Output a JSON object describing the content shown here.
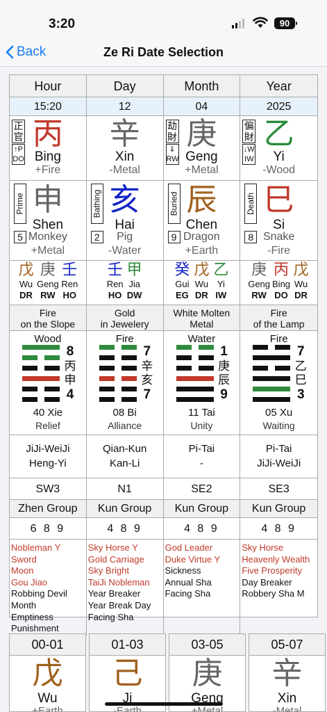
{
  "status": {
    "time": "3:20",
    "battery": "90"
  },
  "nav": {
    "back": "Back",
    "title": "Ze Ri Date Selection"
  },
  "colors": {
    "red": "#c0392b",
    "green": "#2e8b3d",
    "blue": "#1524c8",
    "brown": "#a0611e",
    "gray": "#666666",
    "black": "#111111"
  },
  "pillars": [
    {
      "header": "Hour",
      "value": "15:20",
      "stem": {
        "char": "丙",
        "pinyin": "Bing",
        "element": "+Fire",
        "color": "#c0392b",
        "god_chars": [
          "正",
          "官"
        ],
        "god_abbr": [
          "↑P",
          "DO"
        ]
      },
      "branch": {
        "char": "申",
        "pinyin": "Shen",
        "animal": "Monkey",
        "element": "+Metal",
        "color": "#666666",
        "stage": "Prime",
        "stage_num": "5"
      },
      "hidden": [
        {
          "char": "戊",
          "pinyin": "Wu",
          "god": "DR",
          "color": "#a0611e"
        },
        {
          "char": "庚",
          "pinyin": "Geng",
          "god": "RW",
          "color": "#666666"
        },
        {
          "char": "壬",
          "pinyin": "Ren",
          "god": "HO",
          "color": "#1524c8"
        }
      ],
      "nayin": [
        "Fire",
        "on the Slope"
      ],
      "hexagram": {
        "element": "Wood",
        "name": "40 Xie",
        "meaning": "Relief",
        "num_top": "8",
        "num_bottom": "4",
        "mark_chars": [
          "丙",
          "申"
        ],
        "lines": [
          "g",
          "gb",
          "kb",
          "r",
          "kb",
          "kb"
        ]
      },
      "sequence": [
        "JiJi-WeiJi",
        "Heng-Yi"
      ],
      "direction": "SW3",
      "group": "Zhen Group",
      "numbers": "6 8 9",
      "stars": [
        {
          "text": "Nobleman Y",
          "red": true
        },
        {
          "text": "Sword",
          "red": true
        },
        {
          "text": "Moon",
          "red": true
        },
        {
          "text": "Gou Jiao",
          "red": true
        },
        {
          "text": "Robbing Devil",
          "red": false
        },
        {
          "text": "Month",
          "red": false
        },
        {
          "text": "Emptiness",
          "red": false
        },
        {
          "text": "Punishment",
          "red": false
        }
      ]
    },
    {
      "header": "Day",
      "value": "12",
      "stem": {
        "char": "辛",
        "pinyin": "Xin",
        "element": "-Metal",
        "color": "#666666",
        "god_chars": [],
        "god_abbr": []
      },
      "branch": {
        "char": "亥",
        "pinyin": "Hai",
        "animal": "Pig",
        "element": "-Water",
        "color": "#1524c8",
        "stage": "Bathing",
        "stage_num": "2"
      },
      "hidden": [
        {
          "char": "壬",
          "pinyin": "Ren",
          "god": "HO",
          "color": "#1524c8"
        },
        {
          "char": "甲",
          "pinyin": "Jia",
          "god": "DW",
          "color": "#2e8b3d"
        }
      ],
      "nayin": [
        "Gold",
        "in Jewelery"
      ],
      "hexagram": {
        "element": "Fire",
        "name": "08 Bi",
        "meaning": "Alliance",
        "num_top": "7",
        "num_bottom": "7",
        "mark_chars": [
          "辛",
          "亥"
        ],
        "lines": [
          "gb",
          "kb",
          "kb",
          "rb",
          "kb",
          "kb"
        ]
      },
      "sequence": [
        "Qian-Kun",
        "Kan-Li"
      ],
      "direction": "N1",
      "group": "Kun Group",
      "numbers": "4 8 9",
      "stars": [
        {
          "text": "Sky Horse Y",
          "red": true
        },
        {
          "text": "Gold Carriage",
          "red": true
        },
        {
          "text": "Sky Bright",
          "red": true
        },
        {
          "text": "TaiJi Nobleman",
          "red": true
        },
        {
          "text": "Year Breaker",
          "red": false
        },
        {
          "text": "Year Break Day",
          "red": false
        },
        {
          "text": "Facing Sha",
          "red": false
        }
      ]
    },
    {
      "header": "Month",
      "value": "04",
      "stem": {
        "char": "庚",
        "pinyin": "Geng",
        "element": "+Metal",
        "color": "#666666",
        "god_chars": [
          "劫",
          "財"
        ],
        "god_abbr": [
          "⇓",
          "RW"
        ]
      },
      "branch": {
        "char": "辰",
        "pinyin": "Chen",
        "animal": "Dragon",
        "element": "+Earth",
        "color": "#a0611e",
        "stage": "Buried",
        "stage_num": "9"
      },
      "hidden": [
        {
          "char": "癸",
          "pinyin": "Gui",
          "god": "EG",
          "color": "#1524c8"
        },
        {
          "char": "戊",
          "pinyin": "Wu",
          "god": "DR",
          "color": "#a0611e"
        },
        {
          "char": "乙",
          "pinyin": "Yi",
          "god": "IW",
          "color": "#2e8b3d"
        }
      ],
      "nayin": [
        "White Molten",
        "Metal"
      ],
      "hexagram": {
        "element": "Water",
        "name": "11 Tai",
        "meaning": "Unity",
        "num_top": "1",
        "num_bottom": "9",
        "mark_chars": [
          "庚",
          "辰"
        ],
        "lines": [
          "gb",
          "kb",
          "kb",
          "r",
          "k",
          "k"
        ]
      },
      "sequence": [
        "Pi-Tai",
        "-"
      ],
      "direction": "SE2",
      "group": "Kun Group",
      "numbers": "4 8 9",
      "stars": [
        {
          "text": "God Leader",
          "red": true
        },
        {
          "text": "Duke Virtue Y",
          "red": true
        },
        {
          "text": "Sickness",
          "red": false
        },
        {
          "text": "Annual Sha",
          "red": false
        },
        {
          "text": "Facing Sha",
          "red": false
        }
      ]
    },
    {
      "header": "Year",
      "value": "2025",
      "stem": {
        "char": "乙",
        "pinyin": "Yi",
        "element": "-Wood",
        "color": "#2e8b3d",
        "god_chars": [
          "偏",
          "財"
        ],
        "god_abbr": [
          "↓W",
          "IW"
        ]
      },
      "branch": {
        "char": "巳",
        "pinyin": "Si",
        "animal": "Snake",
        "element": "-Fire",
        "color": "#c0392b",
        "stage": "Death",
        "stage_num": "8"
      },
      "hidden": [
        {
          "char": "庚",
          "pinyin": "Geng",
          "god": "RW",
          "color": "#666666"
        },
        {
          "char": "丙",
          "pinyin": "Bing",
          "god": "DO",
          "color": "#c0392b"
        },
        {
          "char": "戊",
          "pinyin": "Wu",
          "god": "DR",
          "color": "#a0611e"
        }
      ],
      "nayin": [
        "Fire",
        "of the Lamp"
      ],
      "hexagram": {
        "element": "Fire",
        "name": "05 Xu",
        "meaning": "Waiting",
        "num_top": "7",
        "num_bottom": "3",
        "mark_chars": [
          "乙",
          "巳"
        ],
        "lines": [
          "kb",
          "k",
          "kb",
          "k",
          "g",
          "k"
        ]
      },
      "sequence": [
        "Pi-Tai",
        "JiJi-WeiJi"
      ],
      "direction": "SE3",
      "group": "Kun Group",
      "numbers": "4 8 9",
      "stars": [
        {
          "text": "Sky Horse",
          "red": true
        },
        {
          "text": "Heavenly Wealth",
          "red": true
        },
        {
          "text": "Five Prosperity",
          "red": true
        },
        {
          "text": "Day Breaker",
          "red": false
        },
        {
          "text": "Robbery Sha M",
          "red": false
        }
      ]
    }
  ],
  "hours": [
    {
      "range": "00-01",
      "char": "戊",
      "pinyin": "Wu",
      "element": "+Earth",
      "color": "#a0611e"
    },
    {
      "range": "01-03",
      "char": "己",
      "pinyin": "Ji",
      "element": "-Earth",
      "color": "#a0611e"
    },
    {
      "range": "03-05",
      "char": "庚",
      "pinyin": "Geng",
      "element": "+Metal",
      "color": "#666666"
    },
    {
      "range": "05-07",
      "char": "辛",
      "pinyin": "Xin",
      "element": "-Metal",
      "color": "#666666"
    }
  ]
}
